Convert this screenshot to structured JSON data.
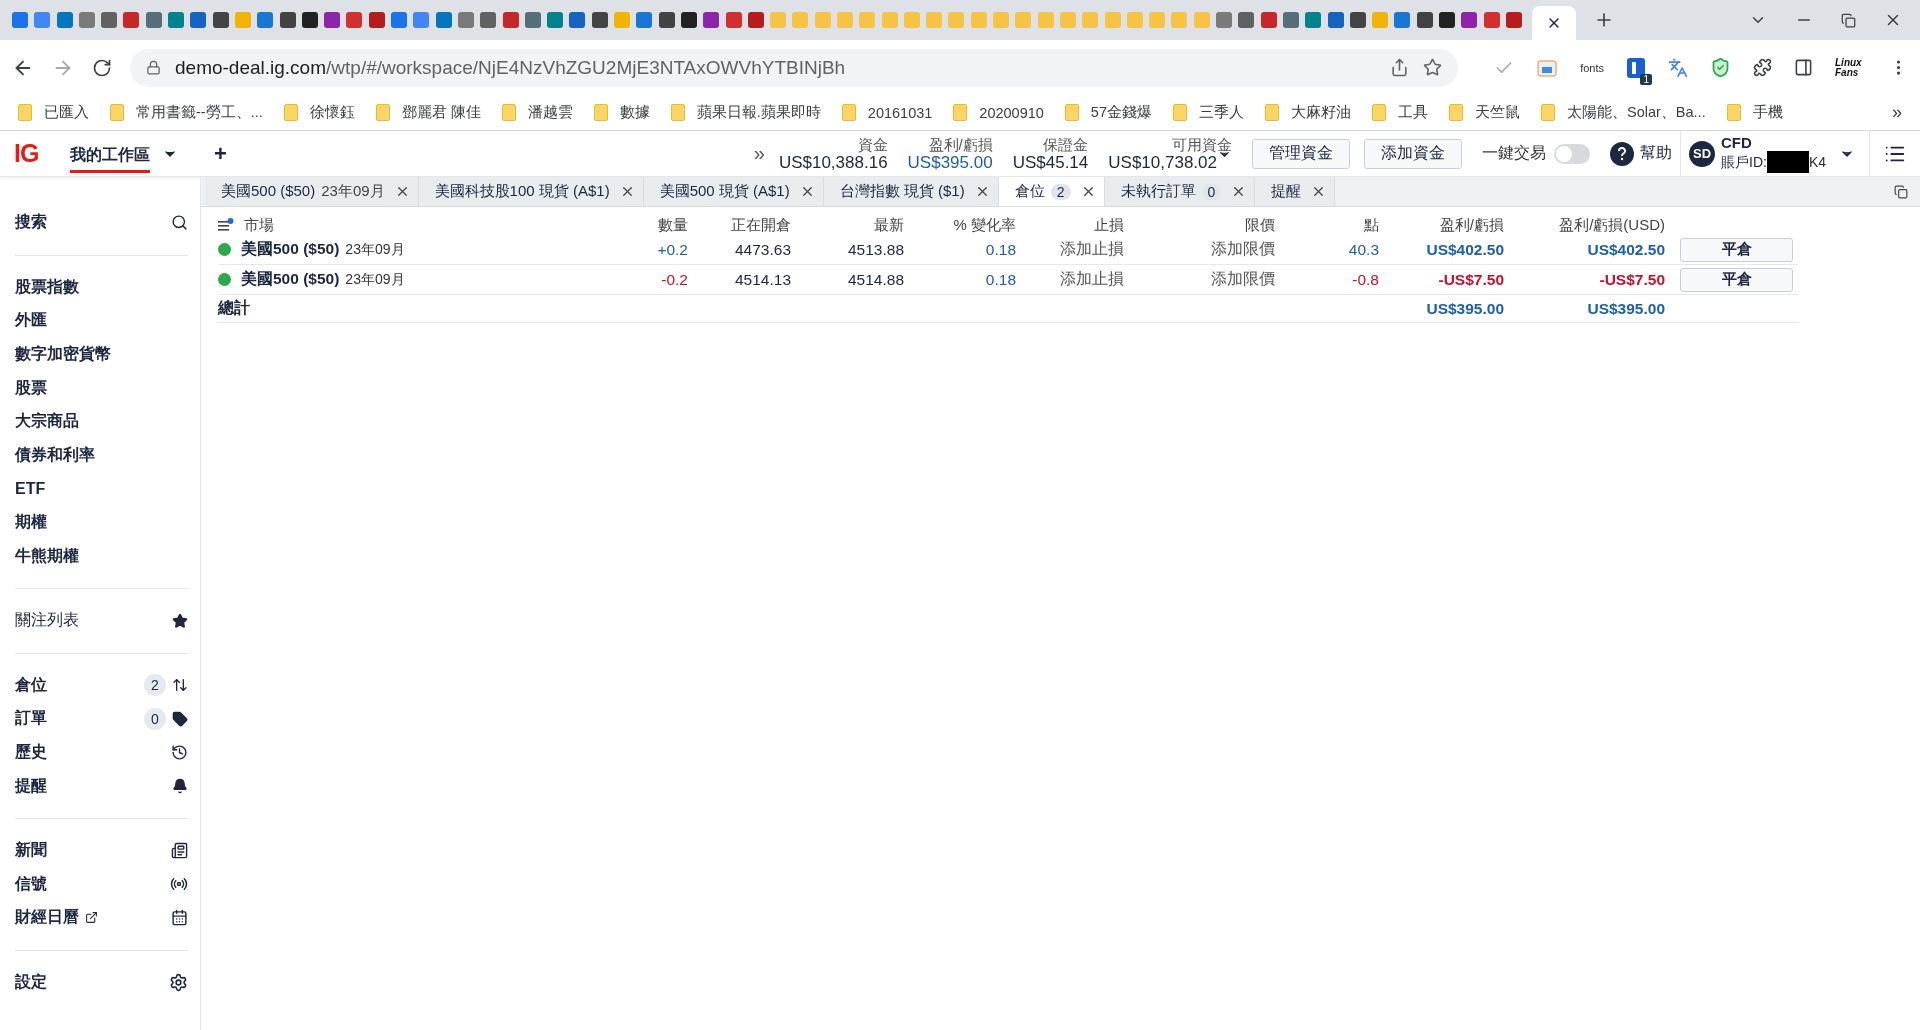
{
  "browser": {
    "address": {
      "host": "demo-deal.ig.com",
      "path": "/wtp/#/workspace/NjE4NzVhZGU2MjE3NTAxOWVhYTBINjBh"
    },
    "extensions": {
      "fonts_label": "fonts",
      "badge": "1",
      "linux_label": "Linux Fans"
    },
    "bookmarks": [
      "已匯入",
      "常用書籤--勞工、...",
      "徐懷鈺",
      "鄧麗君 陳佳",
      "潘越雲",
      "數據",
      "蘋果日報.蘋果即時",
      "20161031",
      "20200910",
      "57金錢爆",
      "三季人",
      "大麻籽油",
      "工具",
      "天竺鼠",
      "太陽能、Solar、Ba...",
      "手機"
    ],
    "bookmarks_more": "»"
  },
  "header": {
    "logo": "IG",
    "workspace": "我的工作區",
    "add": "+",
    "overflow": "»",
    "metrics": [
      {
        "label": "資金",
        "value": "US$10,388.16",
        "color": "#1d2740",
        "dropdown": false
      },
      {
        "label": "盈利/虧損",
        "value": "US$395.00",
        "color": "#1d5fa8",
        "dropdown": false
      },
      {
        "label": "保證金",
        "value": "US$45.14",
        "color": "#1d2740",
        "dropdown": false
      },
      {
        "label": "可用資金",
        "value": "US$10,738.02",
        "color": "#1d2740",
        "dropdown": true
      }
    ],
    "buttons": [
      "管理資金",
      "添加資金"
    ],
    "one_click": {
      "label": "一鍵交易",
      "on": false
    },
    "help": "幫助",
    "account": {
      "avatar": "SD",
      "type": "CFD",
      "id_prefix": "賬戶ID:",
      "id_suffix": "K4"
    }
  },
  "tabs": [
    {
      "label": "美國500 ($50)",
      "sub": "23年09月",
      "selected": false
    },
    {
      "label": "美國科技股100 現貨 (A$1)",
      "selected": false
    },
    {
      "label": "美國500 現貨 (A$1)",
      "selected": false
    },
    {
      "label": "台灣指數 現貨 ($1)",
      "selected": false
    },
    {
      "label": "倉位",
      "count": "2",
      "selected": true
    },
    {
      "label": "未執行訂單",
      "count": "0",
      "selected": false
    },
    {
      "label": "提醒",
      "selected": false
    }
  ],
  "table": {
    "columns": [
      "市場",
      "數量",
      "正在開倉",
      "最新",
      "% 變化率",
      "止損",
      "限價",
      "點",
      "盈利/虧損",
      "盈利/虧損(USD)"
    ],
    "rows": [
      {
        "color": "#2ea84a",
        "market": "美國500 ($50)",
        "expiry": "23年09月",
        "qty": {
          "text": "+0.2",
          "color": "#1d5fa8"
        },
        "open": "4473.63",
        "latest": "4513.88",
        "change": {
          "text": "0.18",
          "color": "#1d5fa8"
        },
        "stop": "添加止損",
        "limit": "添加限價",
        "points": {
          "text": "40.3",
          "color": "#1d5fa8"
        },
        "pnl": {
          "text": "US$402.50",
          "color": "#1d5fa8"
        },
        "pnl_usd": {
          "text": "US$402.50",
          "color": "#1d5fa8"
        },
        "action": "平倉"
      },
      {
        "color": "#2ea84a",
        "market": "美國500 ($50)",
        "expiry": "23年09月",
        "qty": {
          "text": "-0.2",
          "color": "#c8102e"
        },
        "open": "4514.13",
        "latest": "4514.88",
        "change": {
          "text": "0.18",
          "color": "#1d5fa8"
        },
        "stop": "添加止損",
        "limit": "添加限價",
        "points": {
          "text": "-0.8",
          "color": "#c8102e"
        },
        "pnl": {
          "text": "-US$7.50",
          "color": "#c8102e"
        },
        "pnl_usd": {
          "text": "-US$7.50",
          "color": "#c8102e"
        },
        "action": "平倉"
      }
    ],
    "total": {
      "label": "總計",
      "pnl": "US$395.00",
      "pnl_usd": "US$395.00"
    }
  },
  "sidebar": {
    "search": "搜索",
    "markets": [
      "股票指數",
      "外匯",
      "數字加密貨幣",
      "股票",
      "大宗商品",
      "債券和利率",
      "ETF",
      "期權",
      "牛熊期權"
    ],
    "watchlist": "關注列表",
    "activity": [
      {
        "label": "倉位",
        "count": "2",
        "kind": "positions"
      },
      {
        "label": "訂單",
        "count": "0",
        "kind": "orders"
      },
      {
        "label": "歷史",
        "kind": "history"
      },
      {
        "label": "提醒",
        "kind": "alerts"
      }
    ],
    "info": [
      {
        "label": "新聞",
        "kind": "news",
        "external": false
      },
      {
        "label": "信號",
        "kind": "signals",
        "external": false
      },
      {
        "label": "財經日曆",
        "kind": "calendar",
        "external": true
      }
    ],
    "settings": "設定"
  }
}
